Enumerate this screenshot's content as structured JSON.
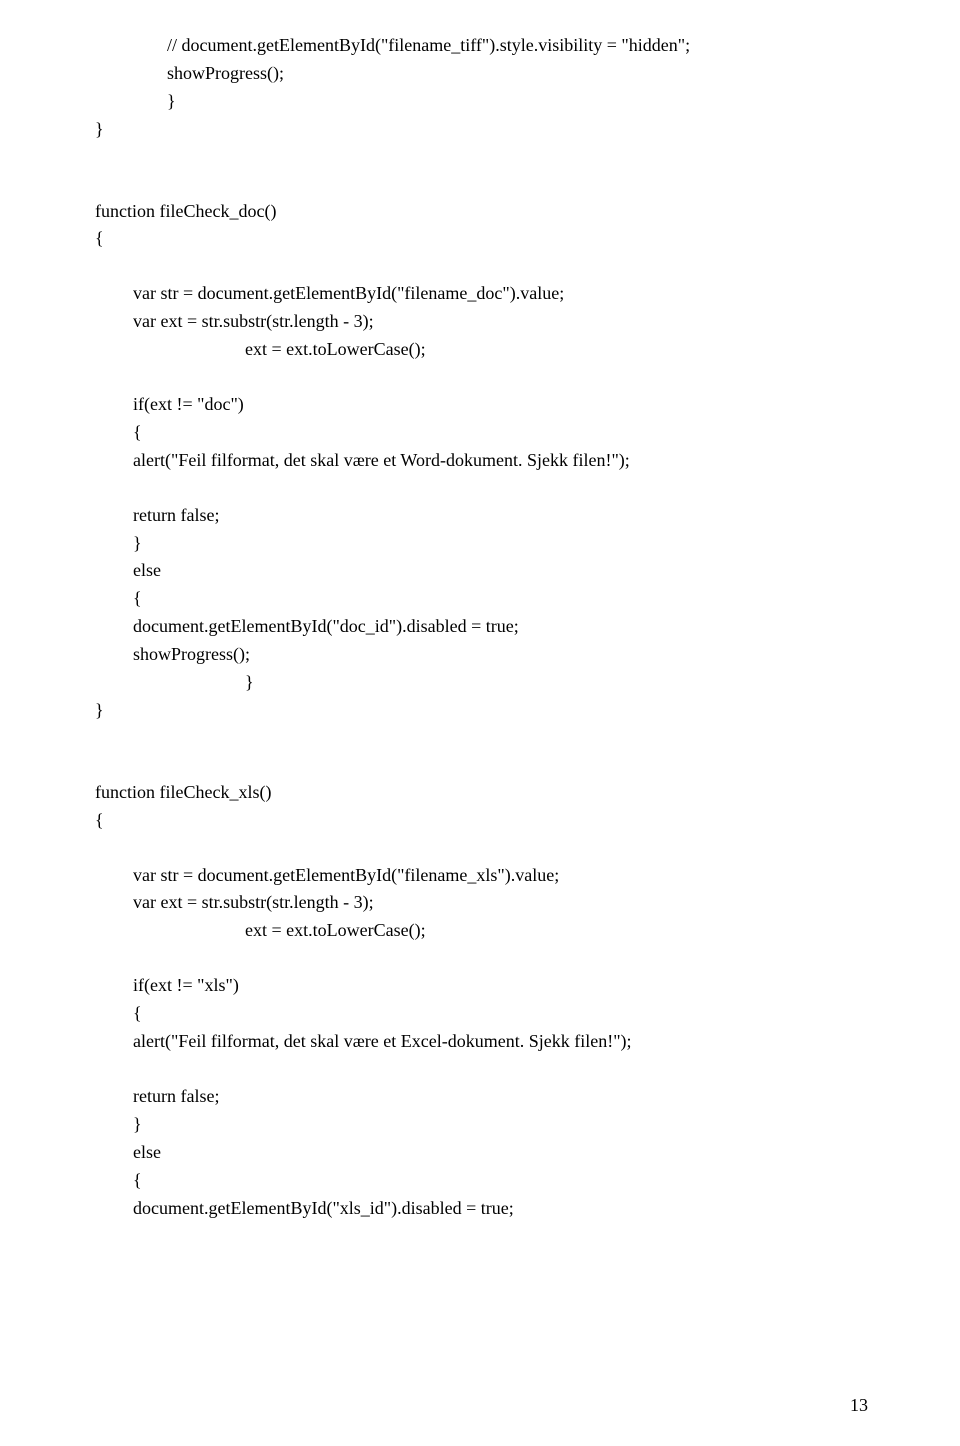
{
  "lines": {
    "l1": "// document.getElementById(\"filename_tiff\").style.visibility = \"hidden\";",
    "l2": "showProgress();",
    "l3": "}",
    "l4": "}",
    "l5": "function fileCheck_doc()",
    "l6": "{",
    "l7": "var str = document.getElementById(\"filename_doc\").value;",
    "l8": "var ext = str.substr(str.length - 3);",
    "l9": "ext = ext.toLowerCase();",
    "l10": "if(ext != \"doc\")",
    "l11": "{",
    "l12": "alert(\"Feil filformat, det skal være et Word-dokument. Sjekk filen!\");",
    "l13": "return false;",
    "l14": "}",
    "l15": "else",
    "l16": "{",
    "l17": "document.getElementById(\"doc_id\").disabled = true;",
    "l18": "showProgress();",
    "l19": "}",
    "l20": "}",
    "l21": "function fileCheck_xls()",
    "l22": "{",
    "l23": "var str = document.getElementById(\"filename_xls\").value;",
    "l24": "var ext = str.substr(str.length - 3);",
    "l25": "ext = ext.toLowerCase();",
    "l26": "if(ext != \"xls\")",
    "l27": "{",
    "l28": "alert(\"Feil filformat, det skal være et Excel-dokument. Sjekk filen!\");",
    "l29": "return false;",
    "l30": "}",
    "l31": "else",
    "l32": "{",
    "l33": "document.getElementById(\"xls_id\").disabled = true;"
  },
  "page_number": "13"
}
